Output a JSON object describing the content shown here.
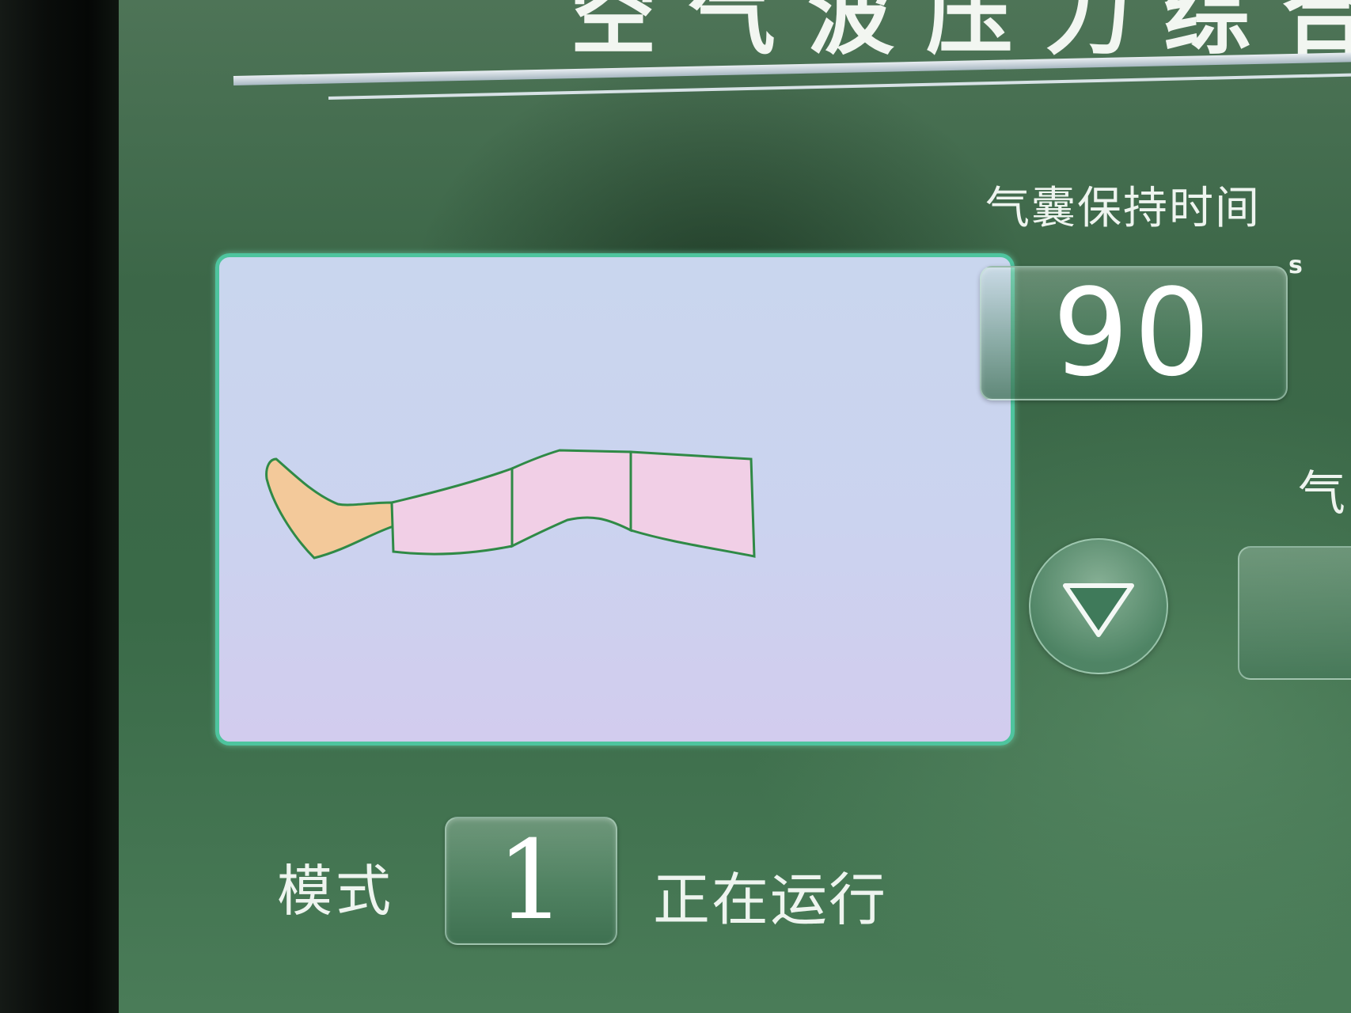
{
  "header": {
    "title": "空气波压力综合治"
  },
  "leg_diagram": {
    "colors": {
      "foot": "#f3c99a",
      "chambers": "#f1cfe6",
      "outline": "#2f8a46",
      "panel_border": "#4ec49e"
    }
  },
  "hold_time": {
    "label": "气囊保持时间",
    "value": "90",
    "unit": "s"
  },
  "controls": {
    "down_icon": "down-triangle-icon"
  },
  "partial": {
    "label": "气"
  },
  "mode": {
    "label": "模式",
    "value": "1",
    "status": "正在运行"
  }
}
